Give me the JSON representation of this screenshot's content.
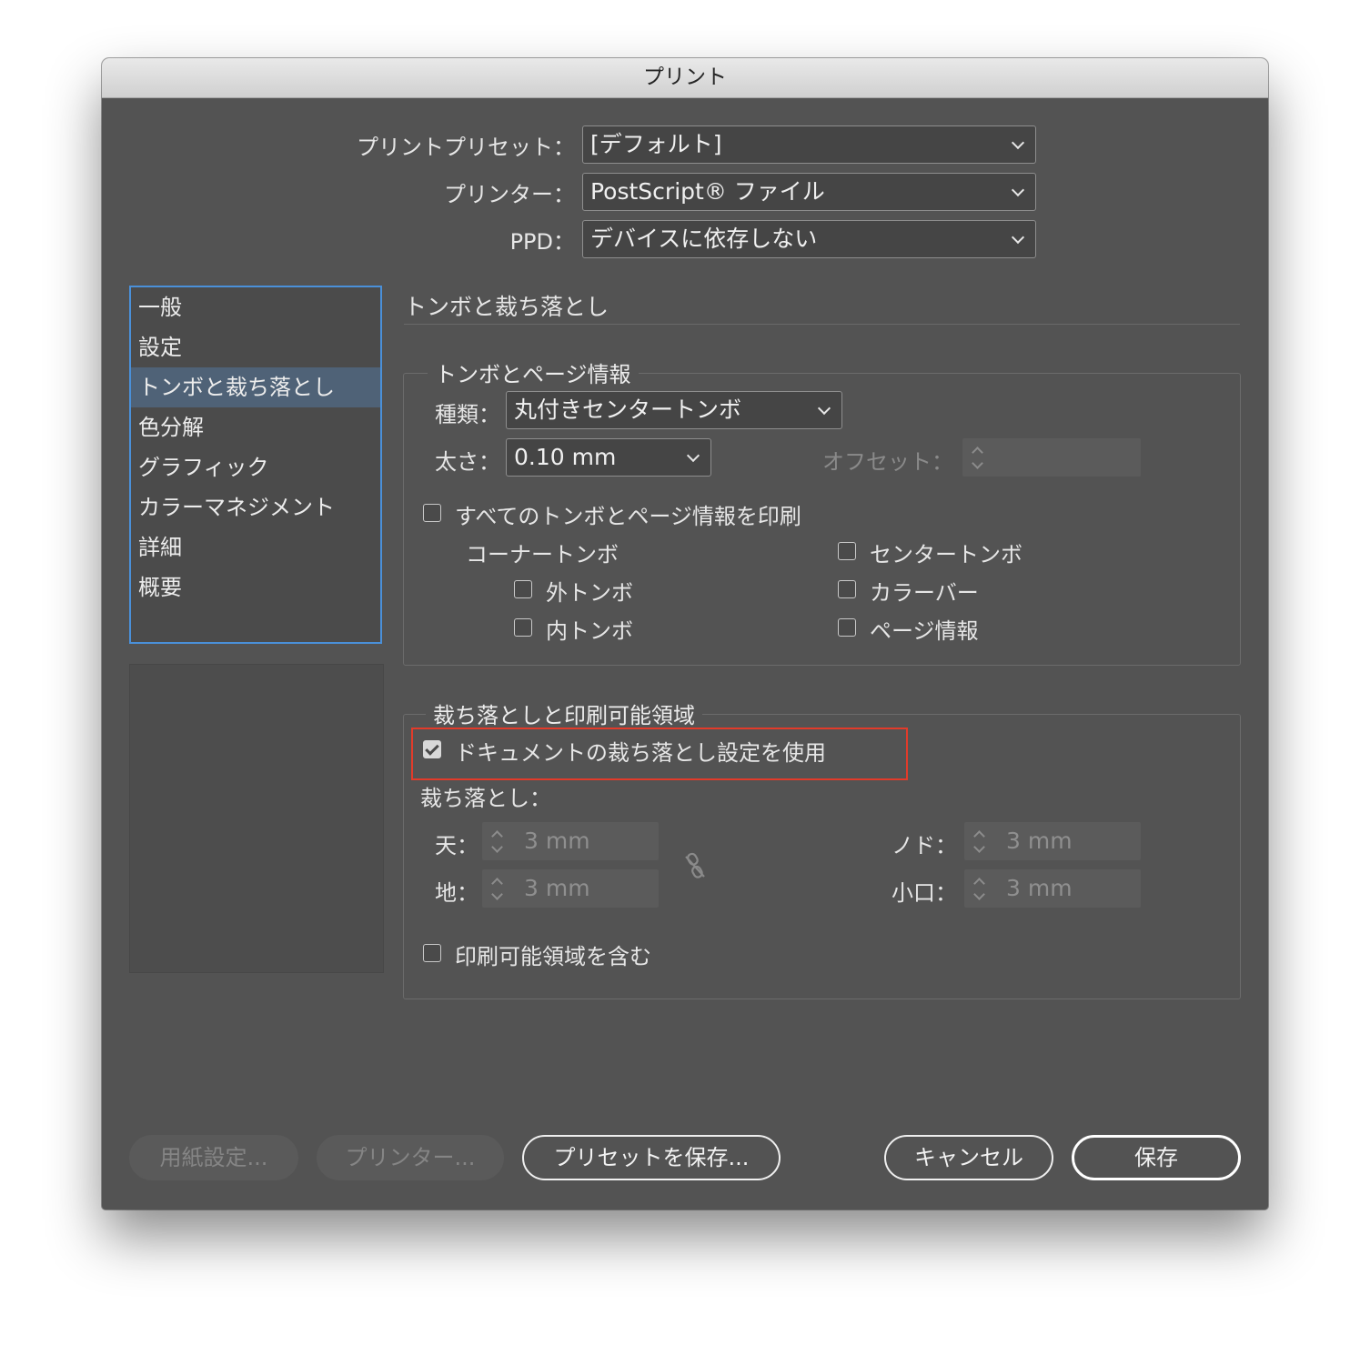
{
  "window": {
    "title": "プリント"
  },
  "header": {
    "preset_label": "プリントプリセット：",
    "preset_value": "[デフォルト]",
    "printer_label": "プリンター：",
    "printer_value": "PostScript® ファイル",
    "ppd_label": "PPD：",
    "ppd_value": "デバイスに依存しない"
  },
  "sidebar": {
    "items": [
      {
        "label": "一般"
      },
      {
        "label": "設定"
      },
      {
        "label": "トンボと裁ち落とし",
        "selected": true
      },
      {
        "label": "色分解"
      },
      {
        "label": "グラフィック"
      },
      {
        "label": "カラーマネジメント"
      },
      {
        "label": "詳細"
      },
      {
        "label": "概要"
      }
    ]
  },
  "panel": {
    "title": "トンボと裁ち落とし",
    "marks": {
      "legend": "トンボとページ情報",
      "type_label": "種類：",
      "type_value": "丸付きセンタートンボ",
      "weight_label": "太さ：",
      "weight_value": "0.10 mm",
      "offset_label": "オフセット：",
      "offset_value": "",
      "all_marks": {
        "label": "すべてのトンボとページ情報を印刷",
        "checked": false
      },
      "corner_marks_heading": "コーナートンボ",
      "outer_marks": {
        "label": "外トンボ",
        "checked": false
      },
      "inner_marks": {
        "label": "内トンボ",
        "checked": false
      },
      "center_marks": {
        "label": "センタートンボ",
        "checked": false
      },
      "color_bars": {
        "label": "カラーバー",
        "checked": false
      },
      "page_info": {
        "label": "ページ情報",
        "checked": false
      }
    },
    "bleed": {
      "legend": "裁ち落としと印刷可能領域",
      "use_doc_bleed": {
        "label": "ドキュメントの裁ち落とし設定を使用",
        "checked": true
      },
      "bleed_heading": "裁ち落とし：",
      "top_label": "天：",
      "top_value": "3 mm",
      "bottom_label": "地：",
      "bottom_value": "3 mm",
      "inside_label": "ノド：",
      "inside_value": "3 mm",
      "outside_label": "小口：",
      "outside_value": "3 mm",
      "link_icon": "broken-link-icon",
      "include_slug": {
        "label": "印刷可能領域を含む",
        "checked": false
      }
    }
  },
  "footer": {
    "page_setup": "用紙設定...",
    "printer": "プリンター...",
    "save_preset": "プリセットを保存...",
    "cancel": "キャンセル",
    "save": "保存"
  },
  "colors": {
    "window_bg": "#535353",
    "selection": "#4f6277",
    "focus_ring": "#4a90d9",
    "highlight_box": "#e23b2a"
  }
}
